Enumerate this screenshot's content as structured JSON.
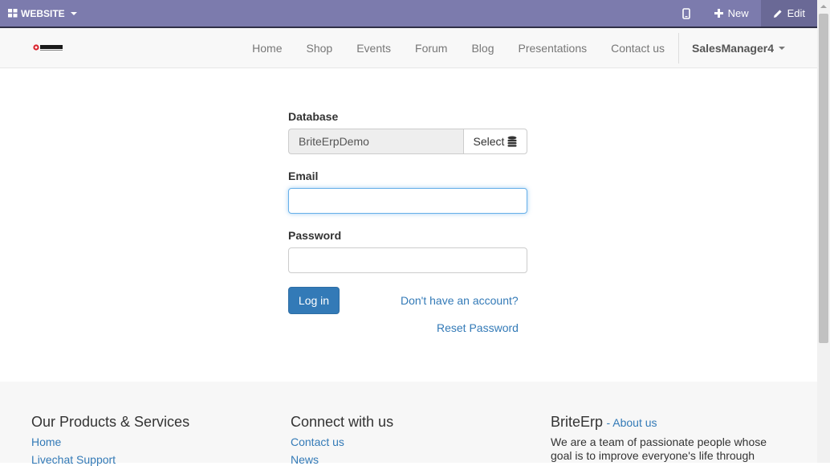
{
  "admin_bar": {
    "website_label": "WEBSITE",
    "new_label": "New",
    "edit_label": "Edit"
  },
  "navbar": {
    "logo_alt": "BRITE ERP",
    "items": [
      "Home",
      "Shop",
      "Events",
      "Forum",
      "Blog",
      "Presentations",
      "Contact us"
    ],
    "user": "SalesManager4"
  },
  "login": {
    "database_label": "Database",
    "database_value": "BriteErpDemo",
    "select_label": "Select",
    "email_label": "Email",
    "email_value": "",
    "password_label": "Password",
    "password_value": "",
    "login_button": "Log in",
    "signup_link": "Don't have an account?",
    "reset_link": "Reset Password"
  },
  "footer": {
    "products_heading": "Our Products & Services",
    "products_links": [
      "Home",
      "Livechat Support"
    ],
    "connect_heading": "Connect with us",
    "connect_links": [
      "Contact us",
      "News"
    ],
    "about_title": "BriteErp",
    "about_link": "- About us",
    "about_text": "We are a team of passionate people whose goal is to improve everyone's life through"
  }
}
